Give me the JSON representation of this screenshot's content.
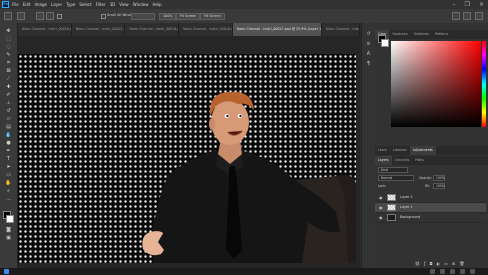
{
  "app": {
    "logo": "Ps",
    "menu": [
      "File",
      "Edit",
      "Image",
      "Layer",
      "Type",
      "Select",
      "Filter",
      "3D",
      "View",
      "Window",
      "Help"
    ],
    "window_controls": [
      "minimize-icon",
      "restore-icon",
      "close-icon"
    ]
  },
  "options": {
    "scroll_all_label": "Scroll All Windows",
    "zoom_100_label": "100%",
    "fit_screen_label": "Fit Screen",
    "fill_screen_label": "Fill Screen"
  },
  "tabs": [
    {
      "label": "Neon Channel - Instrl_00016.psd",
      "active": false
    },
    {
      "label": "Neon Channel - Instrl_00022.psd",
      "active": false
    },
    {
      "label": "Neon Channel - Instrl_00016.psd",
      "active": false
    },
    {
      "label": "Neon Channel - Instrl_00016.psd",
      "active": false
    },
    {
      "label": "Neon Channel - Instrl_00027.psd @ 25.9% (Layer 1, RGB/8)",
      "active": true
    },
    {
      "label": "Neon Channel - Instrl_00016.psd",
      "active": false
    }
  ],
  "color_panel": {
    "tabs": [
      "Color",
      "Swatches",
      "Gradients",
      "Patterns"
    ],
    "active_tab": "Color",
    "foreground": "#000000",
    "background": "#ffffff",
    "hue": "#ff0000"
  },
  "adjust_panel": {
    "tabs": [
      "Learn",
      "Libraries",
      "Adjustments"
    ],
    "active_tab": "Adjustments"
  },
  "layers_panel": {
    "tabs": [
      "Layers",
      "Channels",
      "Paths"
    ],
    "active_tab": "Layers",
    "kind_label": "Kind",
    "blend_mode": "Normal",
    "opacity_label": "Opacity:",
    "opacity_value": "100%",
    "lock_label": "Lock:",
    "fill_label": "Fill:",
    "fill_value": "100%",
    "layers": [
      {
        "name": "Layer 2",
        "selected": false,
        "thumb": "check"
      },
      {
        "name": "Layer 1",
        "selected": true,
        "thumb": "check"
      },
      {
        "name": "Background",
        "selected": false,
        "thumb": "dark"
      }
    ]
  }
}
